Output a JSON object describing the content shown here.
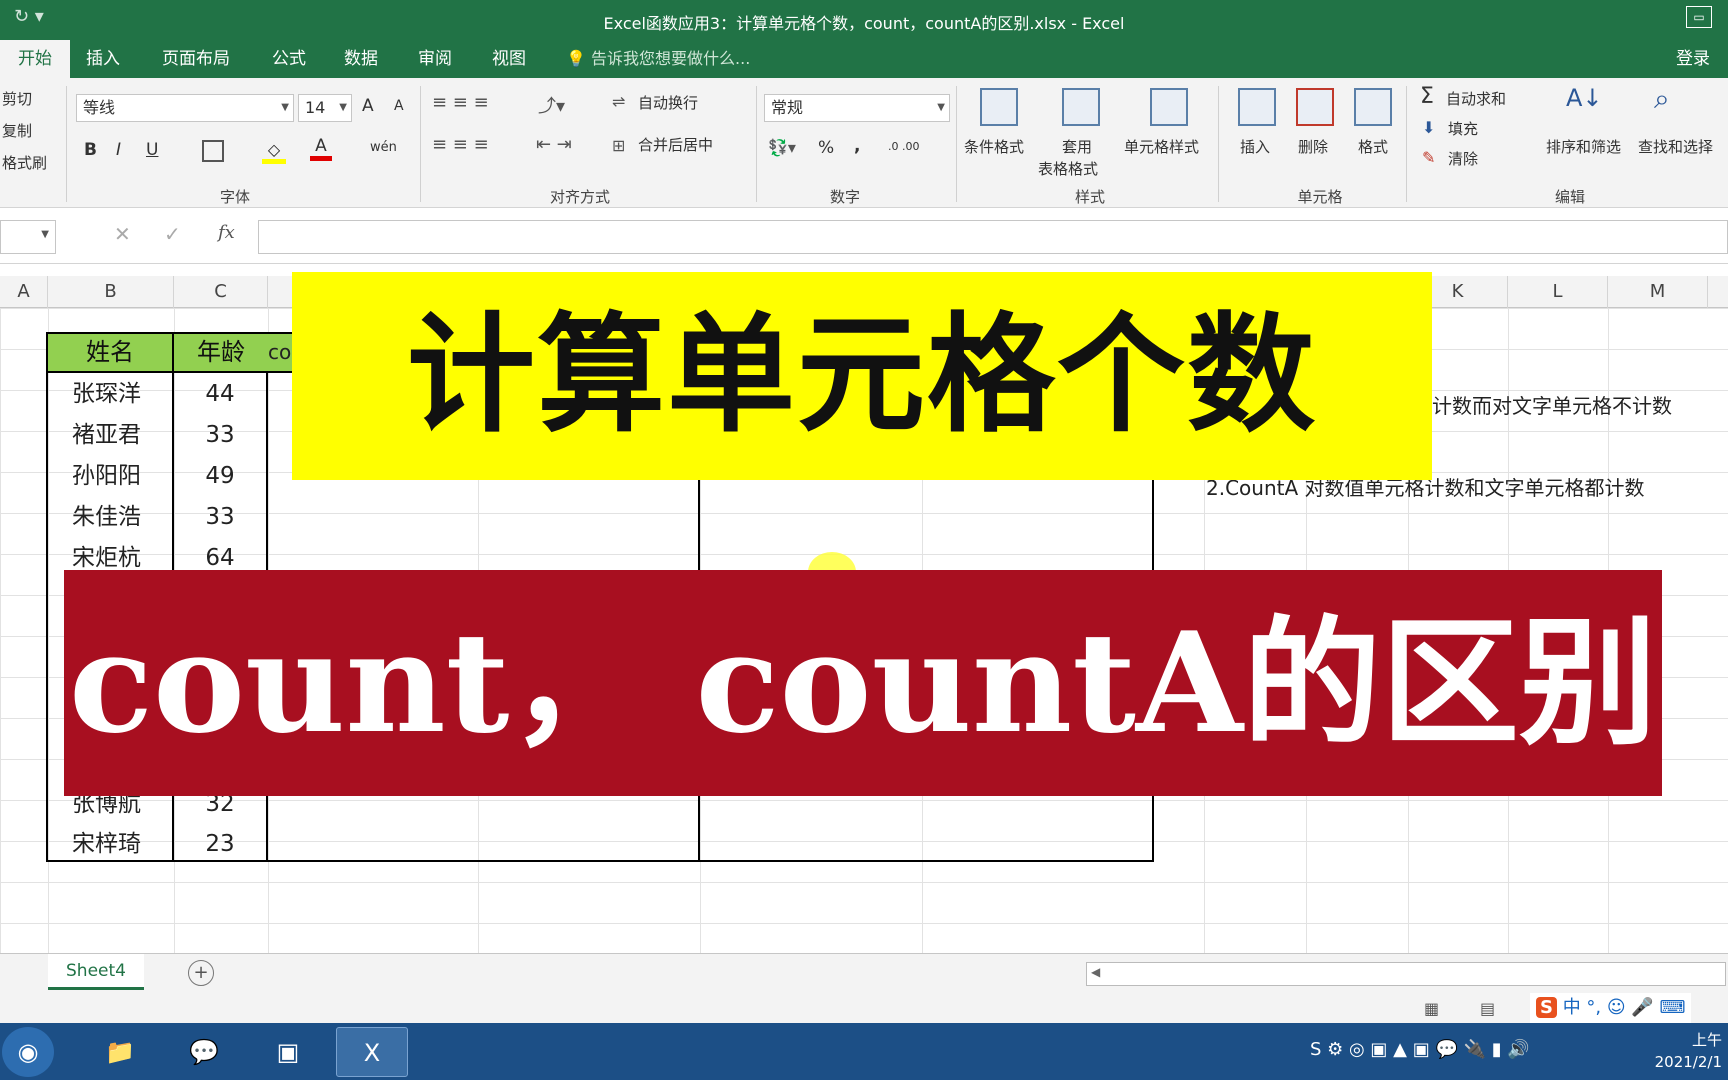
{
  "window": {
    "title": "Excel函数应用3：计算单元格个数，count，countA的区别.xlsx - Excel",
    "quick_access": "↻  ▾",
    "restore_icon": "▭"
  },
  "tabs": [
    {
      "label": "开始",
      "active": true
    },
    {
      "label": "插入"
    },
    {
      "label": "页面布局"
    },
    {
      "label": "公式"
    },
    {
      "label": "数据"
    },
    {
      "label": "审阅"
    },
    {
      "label": "视图"
    }
  ],
  "tell_me": "告诉我您想要做什么...",
  "login": "登录",
  "ribbon": {
    "clipboard": {
      "cut": "剪切",
      "copy": "复制",
      "painter": "格式刷"
    },
    "font": {
      "name": "等线",
      "size": "14",
      "label": "字体",
      "bold": "B",
      "italic": "I",
      "underline": "U",
      "grow": "A",
      "shrink": "A",
      "pinyin": "wén"
    },
    "alignment": {
      "wrap": "自动换行",
      "merge": "合并后居中",
      "label": "对齐方式"
    },
    "number": {
      "format": "常规",
      "label": "数字",
      "percent": "%",
      "comma": ",",
      "inc_decimal": ".0 .00",
      "dec_decimal": ".00 .0"
    },
    "styles": {
      "conditional": "条件格式",
      "table_1": "套用",
      "table_2": "表格格式",
      "cell_styles": "单元格样式",
      "label": "样式"
    },
    "cells": {
      "insert": "插入",
      "delete": "删除",
      "format": "格式",
      "label": "单元格"
    },
    "editing": {
      "autosum": "自动求和",
      "fill": "填充",
      "clear": "清除",
      "sort": "排序和筛选",
      "find": "查找和选择",
      "label": "编辑"
    }
  },
  "formula_bar": {
    "cancel": "✕",
    "confirm": "✓",
    "fx": "fx"
  },
  "columns": [
    "A",
    "B",
    "C",
    "K",
    "L",
    "M"
  ],
  "table": {
    "header": {
      "name": "姓名",
      "age": "年龄",
      "col3": "co"
    },
    "rows": [
      {
        "name": "张琛洋",
        "age": "44"
      },
      {
        "name": "褚亚君",
        "age": "33"
      },
      {
        "name": "孙阳阳",
        "age": "49"
      },
      {
        "name": "朱佳浩",
        "age": "33"
      },
      {
        "name": "宋炬杭",
        "age": "64"
      },
      {
        "name": "张博航",
        "age": "32"
      },
      {
        "name": "宋梓琦",
        "age": "23"
      }
    ]
  },
  "notes": {
    "line1_partial": "计数而对文字单元格不计数",
    "line2": "2.CountA 对数值单元格计数和文字单元格都计数"
  },
  "banners": {
    "yellow": "计算单元格个数",
    "red": "count， countA的区别"
  },
  "sheet": {
    "name": "Sheet4",
    "add": "+"
  },
  "statusbar": {
    "ime": "中 °, ☺ 🎤 ⌨",
    "ime_logo": "S"
  },
  "taskbar": {
    "clock_line1": "上午",
    "clock_line2": "2021/2/1"
  }
}
